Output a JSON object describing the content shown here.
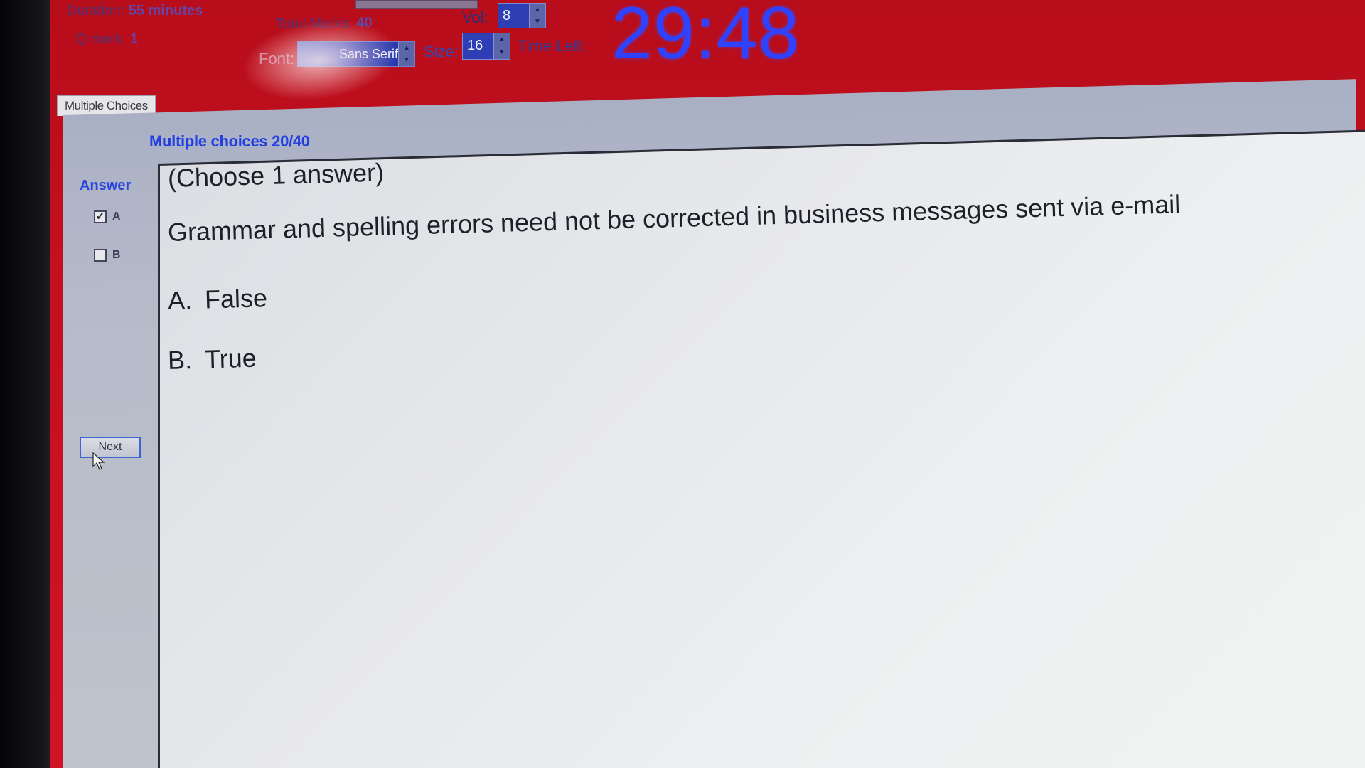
{
  "header": {
    "duration_label": "Duration:",
    "duration_value": "55 minutes",
    "qmark_label": "Q mark:",
    "qmark_value": "1",
    "total_marks_label": "Total Marks:",
    "total_marks_value": "40",
    "vol_label": "Vol:",
    "vol_value": "8",
    "font_label": "Font:",
    "font_value": "Sans Serif",
    "size_label": "Size:",
    "size_value": "16",
    "time_left_label": "Time Left:",
    "timer": "29:48"
  },
  "tab": {
    "label": "Multiple Choices"
  },
  "sidebar": {
    "counter": "Multiple choices 20/40",
    "answer_label": "Answer",
    "options": [
      {
        "letter": "A",
        "checked": true
      },
      {
        "letter": "B",
        "checked": false
      }
    ],
    "next_label": "Next"
  },
  "question": {
    "instruction": "(Choose 1 answer)",
    "text": "Grammar and spelling errors need not be corrected in business messages sent via e-mail",
    "options": [
      {
        "letter": "A.",
        "text": "False"
      },
      {
        "letter": "B.",
        "text": "True"
      }
    ]
  },
  "colors": {
    "header_bg": "#c4101f",
    "timer": "#2f43ff",
    "counter": "#2240e2",
    "question_bg": "#eceef0"
  }
}
